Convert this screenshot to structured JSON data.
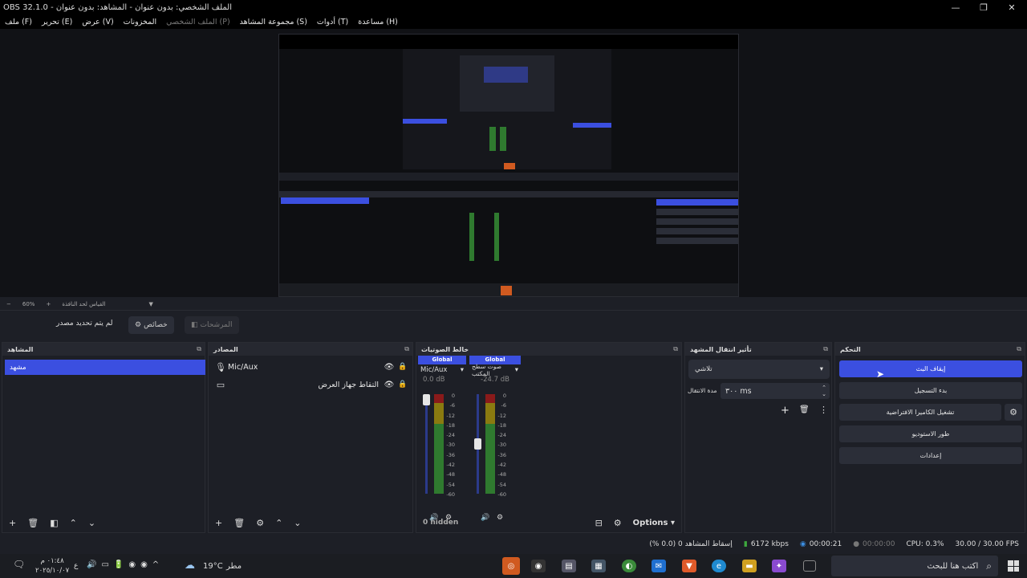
{
  "window": {
    "title": "OBS 32.1.0 - الملف الشخصي: بدون عنوان - المشاهد: بدون عنوان",
    "controls": [
      "—",
      "❐",
      "✕"
    ]
  },
  "menu": [
    "ملف (F)",
    "تحرير (E)",
    "عرض (V)",
    "المخزونات",
    "الملف الشخصي (P)",
    "مجموعة المشاهد (S)",
    "أدوات (T)",
    "مساعدة (H)"
  ],
  "zoom": {
    "minus": "−",
    "value": "60%",
    "plus": "+",
    "label": "القياس لحد النافذة"
  },
  "source_bar": {
    "no_source": "لم يتم تحديد مصدر",
    "properties": "خصائص",
    "filters": "المرشحات",
    "properties_icon": "gear-icon",
    "filters_icon": "filter-icon"
  },
  "scenes": {
    "title": "المشاهد",
    "items": [
      "مشهد"
    ]
  },
  "sources": {
    "title": "المصادر",
    "items": [
      {
        "name": "Mic/Aux",
        "icon": "microphone-icon"
      },
      {
        "name": "التقاط جهاز العرض",
        "icon": "monitor-icon"
      }
    ]
  },
  "mixer": {
    "title": "خالط الصوتيات",
    "channels": [
      {
        "global": "Global",
        "name": "Mic/Aux",
        "db": "0.0 dB",
        "fader_level": 1.0
      },
      {
        "global": "Global",
        "name": "صوت سطح المكتب",
        "db": "-24.7 dB",
        "fader_level": 0.5
      }
    ],
    "ticks": [
      "0",
      "-6",
      "-12",
      "-18",
      "-24",
      "-30",
      "-36",
      "-42",
      "-48",
      "-54",
      "-60"
    ],
    "hidden": "0 hidden",
    "options": "Options"
  },
  "transitions": {
    "title": "تأثير انتقال المشهد",
    "selected": "تلاشي",
    "duration_label": "مدة الانتقال",
    "duration": "٣٠٠ ms"
  },
  "controls": {
    "title": "التحكم",
    "buttons": [
      "إيقاف البث",
      "بدء التسجيل",
      "تشغيل الكاميرا الافتراضية",
      "طور الاستوديو",
      "إعدادات"
    ]
  },
  "status": {
    "dropped": "إسقاط المشاهد 0 (0.0 %)",
    "kbps": "6172 kbps",
    "stream_time": "00:00:21",
    "rec_time": "00:00:00",
    "cpu": "CPU: 0.3%",
    "fps": "30.00 / 30.00 FPS"
  },
  "taskbar": {
    "search": "اكتب هنا للبحث",
    "weather_temp": "19°C",
    "weather_label": "مطر",
    "clock_time": "٠١:٤٨ م",
    "clock_date": "٢٠٢٥/١٠/٠٧",
    "lang": "ع"
  },
  "colors": {
    "accent": "#3b4fe0",
    "background": "#1d1f26",
    "panel_header": "#262830",
    "button": "#2b2e38"
  }
}
